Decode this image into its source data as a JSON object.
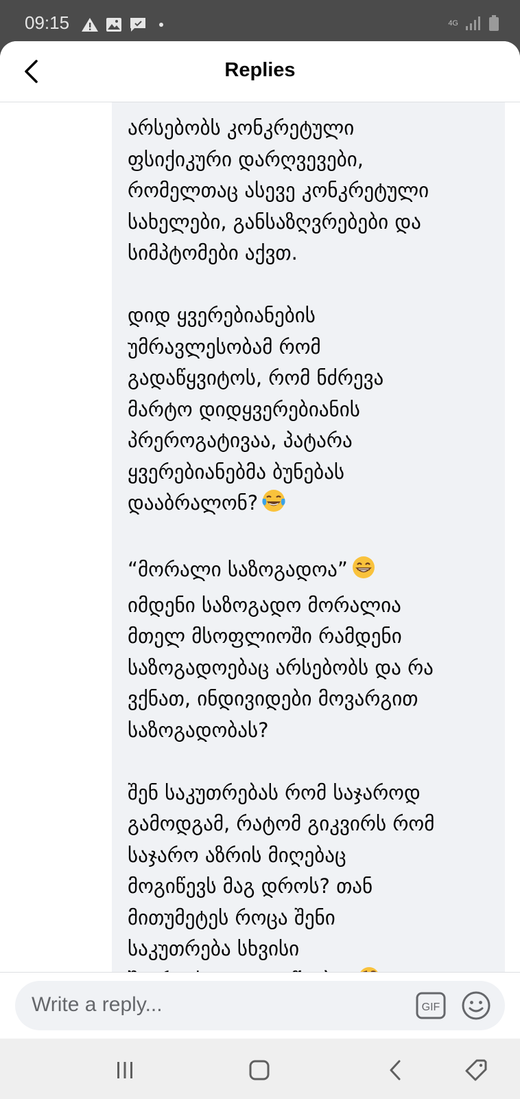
{
  "status_bar": {
    "time": "09:15",
    "network": "4G",
    "icons": [
      "warning-icon",
      "image-icon",
      "chat-check-icon",
      "dot-icon",
      "signal-icon",
      "battery-icon"
    ]
  },
  "header": {
    "title": "Replies",
    "back_icon": "chevron-left-icon"
  },
  "comment": {
    "bubble_color": "#f0f2f5",
    "paragraphs": [
      {
        "lines": [
          "არსებობს კონკრეტული",
          "ფსიქიკური დარღვევები,",
          "რომელთაც ასევე კონკრეტული",
          "სახელები, განსაზღვრებები და",
          "სიმპტომები აქვთ."
        ]
      },
      {
        "lines": [
          "დიდ ყვერებიანების",
          "უმრავლესობამ რომ",
          "გადაწყვიტოს, რომ ნძრევა",
          "მარტო დიდყვერებიანის",
          "პრეროგატივაა, პატარა",
          "ყვერებიანებმა ბუნებას",
          "დააბრალონ?"
        ],
        "emoji": "tears-of-joy-emoji"
      },
      {
        "lines": [
          "“მორალი საზოგადოა”",
          "იმდენი საზოგადო მორალია",
          "მთელ მსოფლიოში რამდენი",
          "საზოგადოებაც არსებობს და რა",
          "ვქნათ, ინდივიდები მოვარგით",
          "საზოგადობას?"
        ],
        "emoji": "grinning-emoji"
      },
      {
        "lines": [
          "შენ საკუთრებას რომ საჯაროდ",
          "გამოდგამ, რატომ გიკვირს რომ",
          "საჯარო აზრის მიღებაც",
          "მოგიწევს მაგ დროს? თან",
          "მითუმეტეს როცა შენი",
          "საკუთრება სხვისი",
          "შეურაცხყოფით იწყება?"
        ],
        "emoji": "thinking-emoji"
      }
    ]
  },
  "reply_bar": {
    "placeholder": "Write a reply...",
    "gif_label": "GIF"
  },
  "nav_bar": {
    "buttons": [
      "recents-icon",
      "home-icon",
      "back-icon",
      "rotate-icon"
    ]
  }
}
